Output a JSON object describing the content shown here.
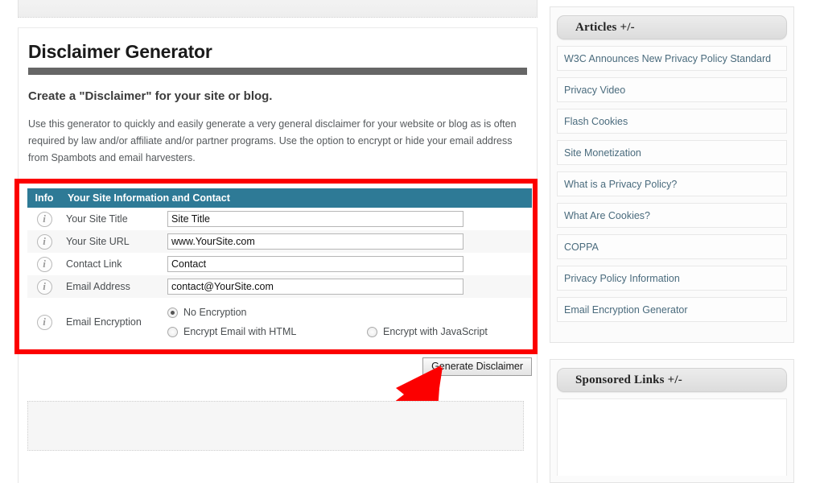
{
  "main": {
    "page_title": "Disclaimer Generator",
    "subtitle": "Create a \"Disclaimer\" for your site or blog.",
    "intro": "Use this generator to quickly and easily generate a very general disclaimer for your website or blog as is often required by law and/or affiliate and/or partner programs. Use the option to encrypt or hide your email address from Spambots and email harvesters.",
    "generate_button": "Generate Disclaimer"
  },
  "form": {
    "header_info": "Info",
    "header_title": "Your Site Information and Contact",
    "info_icon_glyph": "i",
    "rows": [
      {
        "label": "Your Site Title",
        "value": "Site Title"
      },
      {
        "label": "Your Site URL",
        "value": "www.YourSite.com"
      },
      {
        "label": "Contact Link",
        "value": "Contact"
      },
      {
        "label": "Email Address",
        "value": "contact@YourSite.com"
      }
    ],
    "encryption": {
      "label": "Email Encryption",
      "options": [
        {
          "label": "No Encryption",
          "checked": true
        },
        {
          "label": "Encrypt Email with HTML",
          "checked": false
        },
        {
          "label": "Encrypt with JavaScript",
          "checked": false
        }
      ]
    }
  },
  "sidebar": {
    "articles": {
      "header": "Articles +/-",
      "items": [
        {
          "label": "W3C Announces New Privacy Policy Standard"
        },
        {
          "label": "Privacy Video"
        },
        {
          "label": "Flash Cookies"
        },
        {
          "label": "Site Monetization"
        },
        {
          "label": "What is a Privacy Policy?"
        },
        {
          "label": "What Are Cookies?"
        },
        {
          "label": "COPPA"
        },
        {
          "label": "Privacy Policy Information"
        },
        {
          "label": "Email Encryption Generator"
        }
      ]
    },
    "sponsored": {
      "header": "Sponsored Links +/-"
    }
  },
  "annotation": {
    "highlight_color": "#fc0000",
    "arrow_color": "#fc0000"
  },
  "colors": {
    "table_header": "#2e7a96",
    "link": "#4a6b7d",
    "title_rule": "#666666"
  }
}
